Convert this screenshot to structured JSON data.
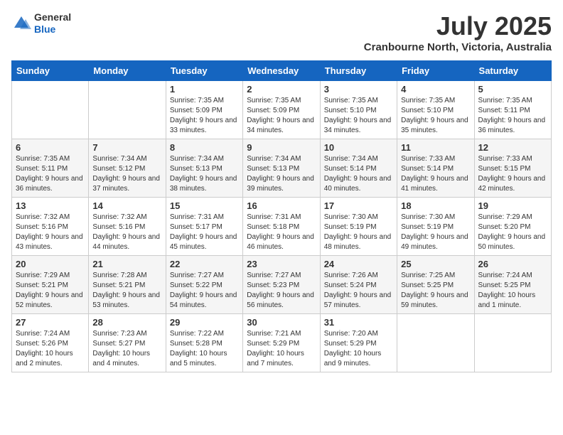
{
  "header": {
    "logo_general": "General",
    "logo_blue": "Blue",
    "month": "July 2025",
    "location": "Cranbourne North, Victoria, Australia"
  },
  "columns": [
    "Sunday",
    "Monday",
    "Tuesday",
    "Wednesday",
    "Thursday",
    "Friday",
    "Saturday"
  ],
  "weeks": [
    [
      {
        "day": "",
        "info": ""
      },
      {
        "day": "",
        "info": ""
      },
      {
        "day": "1",
        "info": "Sunrise: 7:35 AM\nSunset: 5:09 PM\nDaylight: 9 hours and 33 minutes."
      },
      {
        "day": "2",
        "info": "Sunrise: 7:35 AM\nSunset: 5:09 PM\nDaylight: 9 hours and 34 minutes."
      },
      {
        "day": "3",
        "info": "Sunrise: 7:35 AM\nSunset: 5:10 PM\nDaylight: 9 hours and 34 minutes."
      },
      {
        "day": "4",
        "info": "Sunrise: 7:35 AM\nSunset: 5:10 PM\nDaylight: 9 hours and 35 minutes."
      },
      {
        "day": "5",
        "info": "Sunrise: 7:35 AM\nSunset: 5:11 PM\nDaylight: 9 hours and 36 minutes."
      }
    ],
    [
      {
        "day": "6",
        "info": "Sunrise: 7:35 AM\nSunset: 5:11 PM\nDaylight: 9 hours and 36 minutes."
      },
      {
        "day": "7",
        "info": "Sunrise: 7:34 AM\nSunset: 5:12 PM\nDaylight: 9 hours and 37 minutes."
      },
      {
        "day": "8",
        "info": "Sunrise: 7:34 AM\nSunset: 5:13 PM\nDaylight: 9 hours and 38 minutes."
      },
      {
        "day": "9",
        "info": "Sunrise: 7:34 AM\nSunset: 5:13 PM\nDaylight: 9 hours and 39 minutes."
      },
      {
        "day": "10",
        "info": "Sunrise: 7:34 AM\nSunset: 5:14 PM\nDaylight: 9 hours and 40 minutes."
      },
      {
        "day": "11",
        "info": "Sunrise: 7:33 AM\nSunset: 5:14 PM\nDaylight: 9 hours and 41 minutes."
      },
      {
        "day": "12",
        "info": "Sunrise: 7:33 AM\nSunset: 5:15 PM\nDaylight: 9 hours and 42 minutes."
      }
    ],
    [
      {
        "day": "13",
        "info": "Sunrise: 7:32 AM\nSunset: 5:16 PM\nDaylight: 9 hours and 43 minutes."
      },
      {
        "day": "14",
        "info": "Sunrise: 7:32 AM\nSunset: 5:16 PM\nDaylight: 9 hours and 44 minutes."
      },
      {
        "day": "15",
        "info": "Sunrise: 7:31 AM\nSunset: 5:17 PM\nDaylight: 9 hours and 45 minutes."
      },
      {
        "day": "16",
        "info": "Sunrise: 7:31 AM\nSunset: 5:18 PM\nDaylight: 9 hours and 46 minutes."
      },
      {
        "day": "17",
        "info": "Sunrise: 7:30 AM\nSunset: 5:19 PM\nDaylight: 9 hours and 48 minutes."
      },
      {
        "day": "18",
        "info": "Sunrise: 7:30 AM\nSunset: 5:19 PM\nDaylight: 9 hours and 49 minutes."
      },
      {
        "day": "19",
        "info": "Sunrise: 7:29 AM\nSunset: 5:20 PM\nDaylight: 9 hours and 50 minutes."
      }
    ],
    [
      {
        "day": "20",
        "info": "Sunrise: 7:29 AM\nSunset: 5:21 PM\nDaylight: 9 hours and 52 minutes."
      },
      {
        "day": "21",
        "info": "Sunrise: 7:28 AM\nSunset: 5:21 PM\nDaylight: 9 hours and 53 minutes."
      },
      {
        "day": "22",
        "info": "Sunrise: 7:27 AM\nSunset: 5:22 PM\nDaylight: 9 hours and 54 minutes."
      },
      {
        "day": "23",
        "info": "Sunrise: 7:27 AM\nSunset: 5:23 PM\nDaylight: 9 hours and 56 minutes."
      },
      {
        "day": "24",
        "info": "Sunrise: 7:26 AM\nSunset: 5:24 PM\nDaylight: 9 hours and 57 minutes."
      },
      {
        "day": "25",
        "info": "Sunrise: 7:25 AM\nSunset: 5:25 PM\nDaylight: 9 hours and 59 minutes."
      },
      {
        "day": "26",
        "info": "Sunrise: 7:24 AM\nSunset: 5:25 PM\nDaylight: 10 hours and 1 minute."
      }
    ],
    [
      {
        "day": "27",
        "info": "Sunrise: 7:24 AM\nSunset: 5:26 PM\nDaylight: 10 hours and 2 minutes."
      },
      {
        "day": "28",
        "info": "Sunrise: 7:23 AM\nSunset: 5:27 PM\nDaylight: 10 hours and 4 minutes."
      },
      {
        "day": "29",
        "info": "Sunrise: 7:22 AM\nSunset: 5:28 PM\nDaylight: 10 hours and 5 minutes."
      },
      {
        "day": "30",
        "info": "Sunrise: 7:21 AM\nSunset: 5:29 PM\nDaylight: 10 hours and 7 minutes."
      },
      {
        "day": "31",
        "info": "Sunrise: 7:20 AM\nSunset: 5:29 PM\nDaylight: 10 hours and 9 minutes."
      },
      {
        "day": "",
        "info": ""
      },
      {
        "day": "",
        "info": ""
      }
    ]
  ]
}
